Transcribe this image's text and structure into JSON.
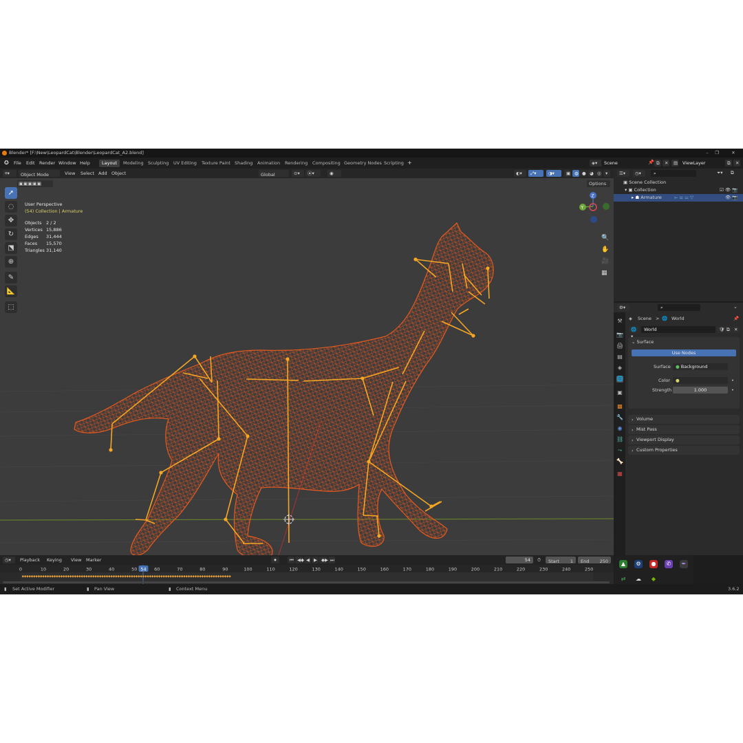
{
  "window": {
    "title": "Blender* [F:\\New\\LeopardCat\\Blender\\LeopardCat_A2.blend]",
    "controls": [
      "–",
      "❐",
      "✕"
    ]
  },
  "menu": [
    "File",
    "Edit",
    "Render",
    "Window",
    "Help"
  ],
  "workspaces": [
    "Layout",
    "Modeling",
    "Sculpting",
    "UV Editing",
    "Texture Paint",
    "Shading",
    "Animation",
    "Rendering",
    "Compositing",
    "Geometry Nodes",
    "Scripting"
  ],
  "workspace_add": "+",
  "scene": {
    "name": "Scene",
    "view_layer": "ViewLayer"
  },
  "viewport_header": {
    "mode": "Object Mode",
    "menus": [
      "View",
      "Select",
      "Add",
      "Object"
    ],
    "orientation": "Global",
    "options": "Options"
  },
  "overlay_text": {
    "perspective": "User Perspective",
    "collection": "(54) Collection | Armature",
    "stats": [
      {
        "label": "Objects",
        "value": "2 / 2"
      },
      {
        "label": "Vertices",
        "value": "15,886"
      },
      {
        "label": "Edges",
        "value": "31,444"
      },
      {
        "label": "Faces",
        "value": "15,570"
      },
      {
        "label": "Triangles",
        "value": "31,140"
      }
    ]
  },
  "gizmo": {
    "z": "Z",
    "y": "Y",
    "x": "X"
  },
  "outliner": {
    "root": "Scene Collection",
    "collection": "Collection",
    "armature": "Armature"
  },
  "properties": {
    "breadcrumb_scene": "Scene",
    "breadcrumb_sep": ">",
    "breadcrumb_world": "World",
    "world_name": "World",
    "surface_panel": "Surface",
    "use_nodes": "Use Nodes",
    "surface_label": "Surface",
    "surface_value": "Background",
    "color_label": "Color",
    "strength_label": "Strength",
    "strength_value": "1.000",
    "collapsed_panels": [
      "Volume",
      "Mist Pass",
      "Viewport Display",
      "Custom Properties"
    ]
  },
  "timeline": {
    "menus": [
      "Playback",
      "Keying",
      "View",
      "Marker"
    ],
    "current_frame": "54",
    "start_label": "Start",
    "start_value": "1",
    "end_label": "End",
    "end_value": "250",
    "ruler": [
      "0",
      "10",
      "20",
      "30",
      "40",
      "50",
      "54",
      "60",
      "70",
      "80",
      "90",
      "100",
      "110",
      "120",
      "130",
      "140",
      "150",
      "160",
      "170",
      "180",
      "190",
      "200",
      "210",
      "220",
      "230",
      "240",
      "250"
    ],
    "transport": [
      "⏺",
      "⏮",
      "◀◆",
      "◀",
      "▶",
      "◆▶",
      "⏭"
    ]
  },
  "statusbar": {
    "hint1": "Set Active Modifier",
    "hint2": "Pan View",
    "hint3": "Context Menu",
    "version": "3.6.2"
  },
  "colors": {
    "accent_blue": "#4772b3",
    "wire": "#e0531c",
    "bone": "#f5a623",
    "bg": "#3c3c3c"
  },
  "icons": {
    "tools": [
      "tweak-icon",
      "select-circle-icon",
      "move-icon",
      "rotate-icon",
      "scale-icon",
      "transform-icon",
      "annotate-icon",
      "measure-icon",
      "add-cube-icon"
    ],
    "nav": [
      "zoom-icon",
      "pan-hand-icon",
      "camera-icon",
      "grid-icon"
    ],
    "prop_tabs": [
      "tool-icon",
      "render-icon",
      "output-icon",
      "view-layer-icon",
      "scene-icon",
      "world-icon",
      "collection-icon",
      "object-icon",
      "modifier-icon",
      "particles-icon",
      "physics-icon",
      "constraints-icon",
      "data-icon",
      "bone-icon",
      "texture-icon"
    ]
  }
}
